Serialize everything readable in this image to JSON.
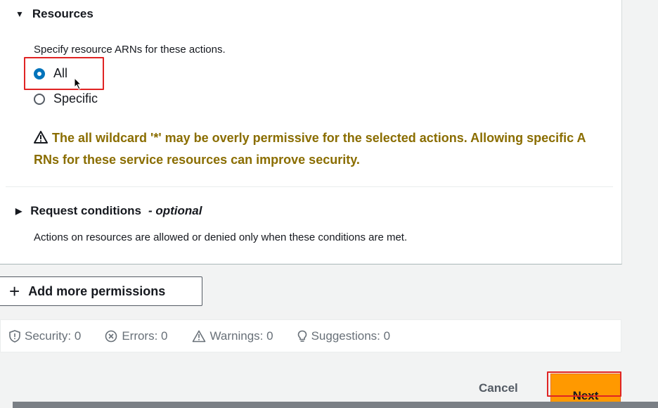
{
  "resources": {
    "header": "Resources",
    "description": "Specify resource ARNs for these actions.",
    "options": [
      {
        "label": "All",
        "selected": true
      },
      {
        "label": "Specific",
        "selected": false
      }
    ],
    "warning": "The all wildcard '*' may be overly permissive for the selected actions. Allowing specific A RNs for these service resources can improve security."
  },
  "request_conditions": {
    "header": "Request conditions",
    "optional": "- optional",
    "description": "Actions on resources are allowed or denied only when these conditions are met."
  },
  "add_permissions": {
    "label": "Add more permissions"
  },
  "status": {
    "security": "Security: 0",
    "errors": "Errors: 0",
    "warnings": "Warnings: 0",
    "suggestions": "Suggestions: 0"
  },
  "footer": {
    "cancel": "Cancel",
    "next": "Next"
  },
  "colors": {
    "warning": "#8a6d00",
    "primary": "#ff9900",
    "radio": "#0073bb",
    "highlight": "#e02424"
  }
}
